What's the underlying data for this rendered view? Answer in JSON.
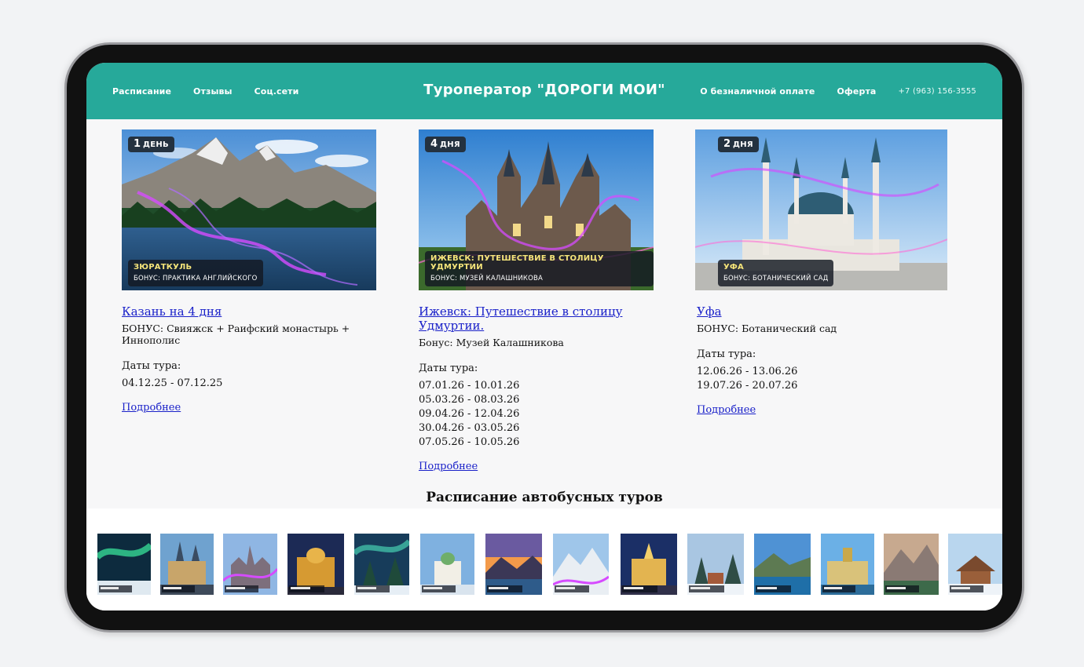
{
  "header": {
    "nav_left": [
      "Расписание",
      "Отзывы",
      "Соц.сети"
    ],
    "title": "Туроператор \"ДОРОГИ МОИ\"",
    "nav_right": [
      "О безналичной оплате",
      "Оферта"
    ],
    "phone": "+7 (963) 156-3555"
  },
  "tours": [
    {
      "badge_num": "1",
      "badge_word": "ДЕНЬ",
      "img_title": "ЗЮРАТКУЛЬ",
      "img_sub": "БОНУС: ПРАКТИКА АНГЛИЙСКОГО",
      "link": "Казань на 4 дня",
      "bonus": "БОНУС: Свияжск + Раифский монастырь + Иннополис",
      "dates_label": "Даты тура:",
      "dates": [
        "04.12.25 - 07.12.25"
      ],
      "more": "Подробнее"
    },
    {
      "badge_num": "4",
      "badge_word": "ДНЯ",
      "img_title": "ИЖЕВСК: ПУТЕШЕСТВИЕ В СТОЛИЦУ УДМУРТИИ",
      "img_sub": "БОНУС: МУЗЕЙ КАЛАШНИКОВА",
      "link": "Ижевск: Путешествие в столицу Удмуртии.",
      "bonus": "Бонус: Музей Калашникова",
      "dates_label": "Даты тура:",
      "dates": [
        "07.01.26 - 10.01.26",
        "05.03.26 - 08.03.26",
        "09.04.26 - 12.04.26",
        "30.04.26 - 03.05.26",
        "07.05.26 - 10.05.26"
      ],
      "more": "Подробнее"
    },
    {
      "badge_num": "2",
      "badge_word": "ДНЯ",
      "img_title": "УФА",
      "img_sub": "БОНУС: БОТАНИЧЕСКИЙ САД",
      "link": "Уфа",
      "bonus": "БОНУС: Ботанический сад",
      "dates_label": "Даты тура:",
      "dates": [
        "12.06.26 - 13.06.26",
        "19.07.26 - 20.07.26"
      ],
      "more": "Подробнее"
    }
  ],
  "schedule": {
    "title": "Расписание автобусных туров"
  },
  "colors": {
    "header_bg": "#26a99a",
    "link": "#1a21c9",
    "badge_bg": "#243240",
    "caption_title": "#f5e47a"
  }
}
